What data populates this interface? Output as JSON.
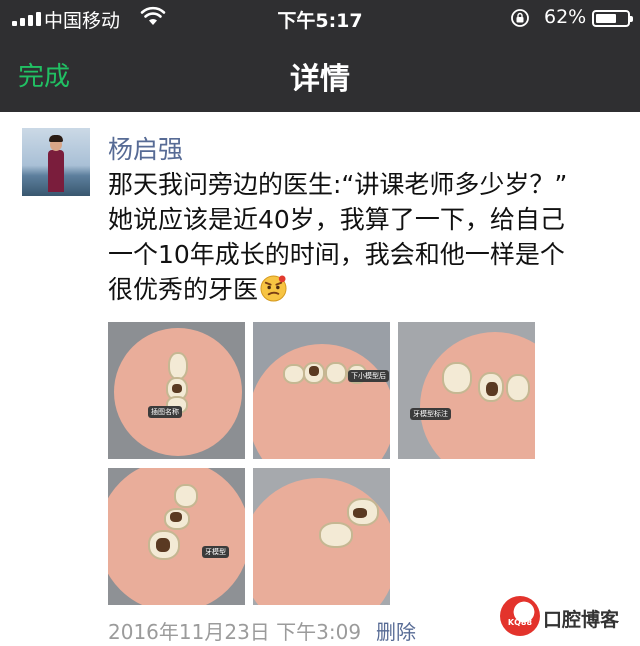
{
  "status_bar": {
    "carrier": "中国移动",
    "time": "下午5:17",
    "battery_percent": "62%",
    "battery_level": 0.62,
    "icons": [
      "signal-icon",
      "wifi-icon",
      "rotation-lock-icon",
      "battery-icon"
    ]
  },
  "nav": {
    "left_button": "完成",
    "title": "详情",
    "accent_color": "#21c063"
  },
  "post": {
    "author": "杨启强",
    "text_lines": [
      "那天我问旁边的医生:“讲课老师多少岁？”",
      "她说应该是近40岁，我算了一下，给自己",
      "一个10年成长的时间，我会和他一样是个",
      "很优秀的牙医"
    ],
    "emoji": "smirk-emoji-icon",
    "photos": [
      {
        "name": "dental-photo-1",
        "label": "插图名称"
      },
      {
        "name": "dental-photo-2",
        "label": "下小模型后"
      },
      {
        "name": "dental-photo-3",
        "label": "牙模型标注"
      },
      {
        "name": "dental-photo-4",
        "label": "牙模型"
      },
      {
        "name": "dental-photo-5",
        "label": ""
      }
    ],
    "timestamp": "2016年11月23日 下午3:09",
    "delete_label": "删除",
    "link_color": "#576b95"
  },
  "watermark": {
    "logo_text": "KQ88",
    "brand": "口腔博客"
  }
}
